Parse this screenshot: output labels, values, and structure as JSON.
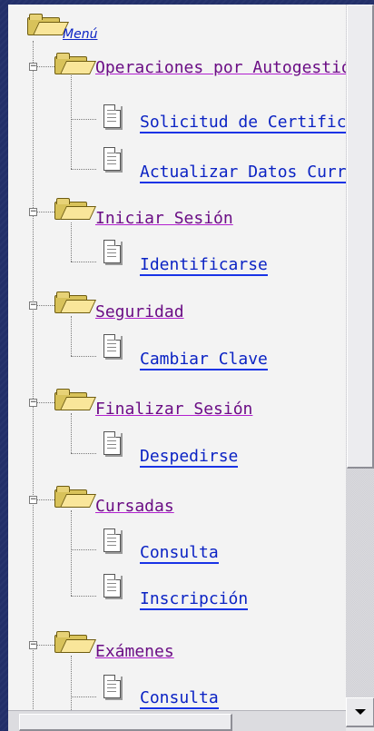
{
  "menu": {
    "root_label": "Menú",
    "groups": [
      {
        "label": "Operaciones por Autogestión",
        "items": [
          "Solicitud de Certificados",
          "Actualizar Datos Curriculares"
        ]
      },
      {
        "label": "Iniciar Sesión",
        "items": [
          "Identificarse"
        ]
      },
      {
        "label": "Seguridad",
        "items": [
          "Cambiar Clave"
        ]
      },
      {
        "label": "Finalizar Sesión",
        "items": [
          "Despedirse"
        ]
      },
      {
        "label": "Cursadas",
        "items": [
          "Consulta",
          "Inscripción"
        ]
      },
      {
        "label": "Exámenes",
        "items": [
          "Consulta"
        ]
      }
    ]
  },
  "icons": {
    "root": "open-folder-icon",
    "group": "open-folder-icon",
    "item": "document-icon",
    "toggle": "minus-toggle-icon"
  },
  "colors": {
    "background": "#23306b",
    "link": "#0b23c4",
    "visited_link": "#6a0d84",
    "panel": "#f3f3f3"
  }
}
